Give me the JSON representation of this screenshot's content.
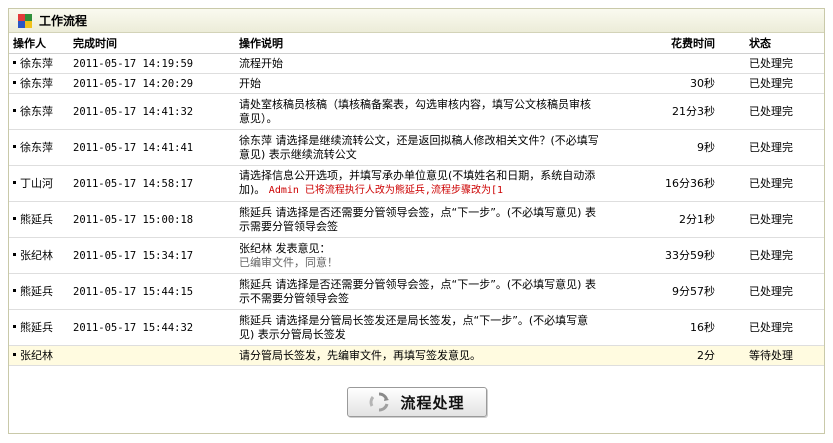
{
  "panel": {
    "title": "工作流程"
  },
  "columns": {
    "operator": "操作人",
    "done_time": "完成时间",
    "desc": "操作说明",
    "cost": "花费时间",
    "status": "状态"
  },
  "rows": [
    {
      "operator": "徐东萍",
      "time": "2011-05-17 14:19:59",
      "desc": "流程开始",
      "cost": "",
      "status": "已处理完"
    },
    {
      "operator": "徐东萍",
      "time": "2011-05-17 14:20:29",
      "desc": "开始",
      "cost": "30秒",
      "status": "已处理完"
    },
    {
      "operator": "徐东萍",
      "time": "2011-05-17 14:41:32",
      "desc": "请处室核稿员核稿（填核稿备案表，勾选审核内容，填写公文核稿员审核意见）。",
      "cost": "21分3秒",
      "status": "已处理完"
    },
    {
      "operator": "徐东萍",
      "time": "2011-05-17 14:41:41",
      "desc": "徐东萍 请选择是继续流转公文，还是返回拟稿人修改相关文件？(不必填写意见) 表示继续流转公文",
      "cost": "9秒",
      "status": "已处理完"
    },
    {
      "operator": "丁山河",
      "time": "2011-05-17 14:58:17",
      "desc": "请选择信息公开选项，并填写承办单位意见(不填姓名和日期，系统自动添加)。",
      "desc_red": "Admin 已将流程执行人改为熊延兵,流程步骤改为[1",
      "cost": "16分36秒",
      "status": "已处理完"
    },
    {
      "operator": "熊延兵",
      "time": "2011-05-17 15:00:18",
      "desc": "熊延兵 请选择是否还需要分管领导会签，点“下一步”。(不必填写意见) 表示需要分管领导会签",
      "cost": "2分1秒",
      "status": "已处理完"
    },
    {
      "operator": "张纪林",
      "time": "2011-05-17 15:34:17",
      "desc": "张纪林 发表意见：",
      "desc_grey": "已编审文件，同意！",
      "cost": "33分59秒",
      "status": "已处理完"
    },
    {
      "operator": "熊延兵",
      "time": "2011-05-17 15:44:15",
      "desc": "熊延兵 请选择是否还需要分管领导会签，点“下一步”。(不必填写意见) 表示不需要分管领导会签",
      "cost": "9分57秒",
      "status": "已处理完"
    },
    {
      "operator": "熊延兵",
      "time": "2011-05-17 15:44:32",
      "desc": "熊延兵 请选择是分管局长签发还是局长签发，点“下一步”。(不必填写意见) 表示分管局长签发",
      "cost": "16秒",
      "status": "已处理完"
    },
    {
      "operator": "张纪林",
      "time": "",
      "desc": "请分管局长签发，先编审文件，再填写签发意见。",
      "cost": "2分",
      "status": "等待处理"
    }
  ],
  "button": {
    "label": "流程处理",
    "icon": "refresh-icon"
  }
}
